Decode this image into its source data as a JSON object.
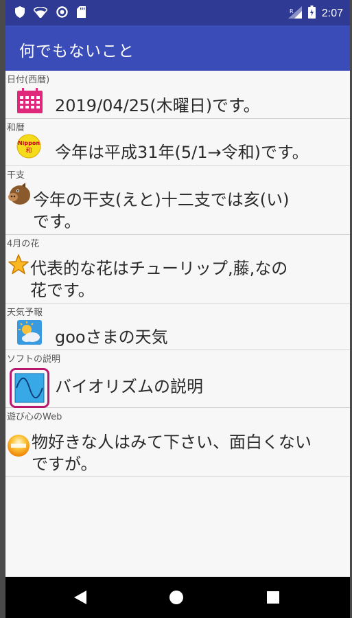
{
  "status_bar": {
    "time": "2:07",
    "icons": [
      "shield-icon",
      "wifi-off-icon",
      "circle-icon",
      "sd-card-icon",
      "signal-icon",
      "battery-icon"
    ]
  },
  "app_bar": {
    "title": "何でもないこと",
    "color": "#3a4cb8"
  },
  "rows": [
    {
      "label": "日付(西暦)",
      "text": "2019/04/25(木曜日)です。",
      "icon": "calendar-icon"
    },
    {
      "label": "和暦",
      "text": "今年は平成31年(5/1→令和)です。",
      "icon": "nippon-badge-icon",
      "icon_text": "Nippon 和"
    },
    {
      "label": "干支",
      "text": "今年の干支(えと)十二支では亥(い)です。",
      "icon": "boar-icon"
    },
    {
      "label": "4月の花",
      "text": "代表的な花はチューリップ,藤,なの花です。",
      "icon": "star-icon"
    },
    {
      "label": "天気予報",
      "text": "gooさまの天気",
      "icon": "weather-icon"
    },
    {
      "label": "ソフトの説明",
      "text": "バイオリズムの説明",
      "icon": "biorhythm-icon"
    },
    {
      "label": "遊び心のWeb",
      "text": "物好きな人はみて下さい、面白くないですが。",
      "icon": "sun-face-icon"
    }
  ],
  "nav_bar": {
    "buttons": [
      "back-icon",
      "home-icon",
      "recents-icon"
    ]
  }
}
